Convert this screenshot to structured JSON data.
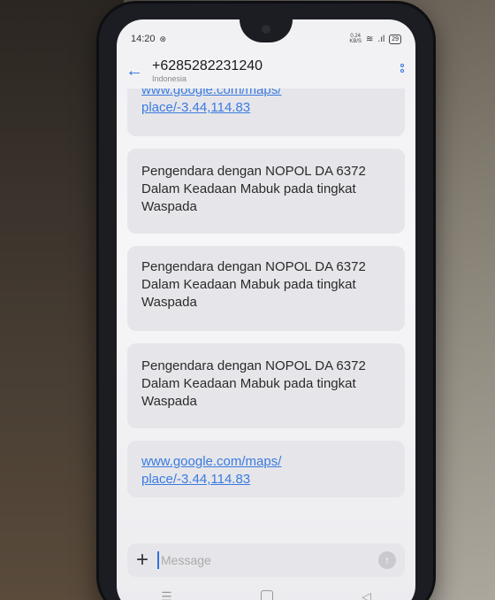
{
  "status_bar": {
    "time": "14:20",
    "network_speed_value": "0.24",
    "network_speed_unit": "KB/S",
    "battery": "29"
  },
  "header": {
    "number": "+6285282231240",
    "country": "Indonesia"
  },
  "messages": [
    {
      "type": "link",
      "text": "www.google.com/maps/ place/-3.44,114.83"
    },
    {
      "type": "text",
      "text": "Pengendara dengan NOPOL DA 6372 Dalam Keadaan Mabuk pada tingkat Waspada"
    },
    {
      "type": "text",
      "text": "Pengendara dengan NOPOL DA 6372 Dalam Keadaan Mabuk pada tingkat Waspada"
    },
    {
      "type": "text",
      "text": "Pengendara dengan NOPOL DA 6372 Dalam Keadaan Mabuk pada tingkat Waspada"
    },
    {
      "type": "link",
      "text": "www.google.com/maps/ place/-3.44,114.83"
    }
  ],
  "composer": {
    "placeholder": "Message",
    "plus_glyph": "+",
    "send_glyph": "↑"
  },
  "navbar": {
    "menu_glyph": "☰",
    "back_glyph": "◁"
  },
  "colors": {
    "accent": "#2f73d8",
    "link": "#3a7be0",
    "bubble": "#e6e6ea"
  }
}
